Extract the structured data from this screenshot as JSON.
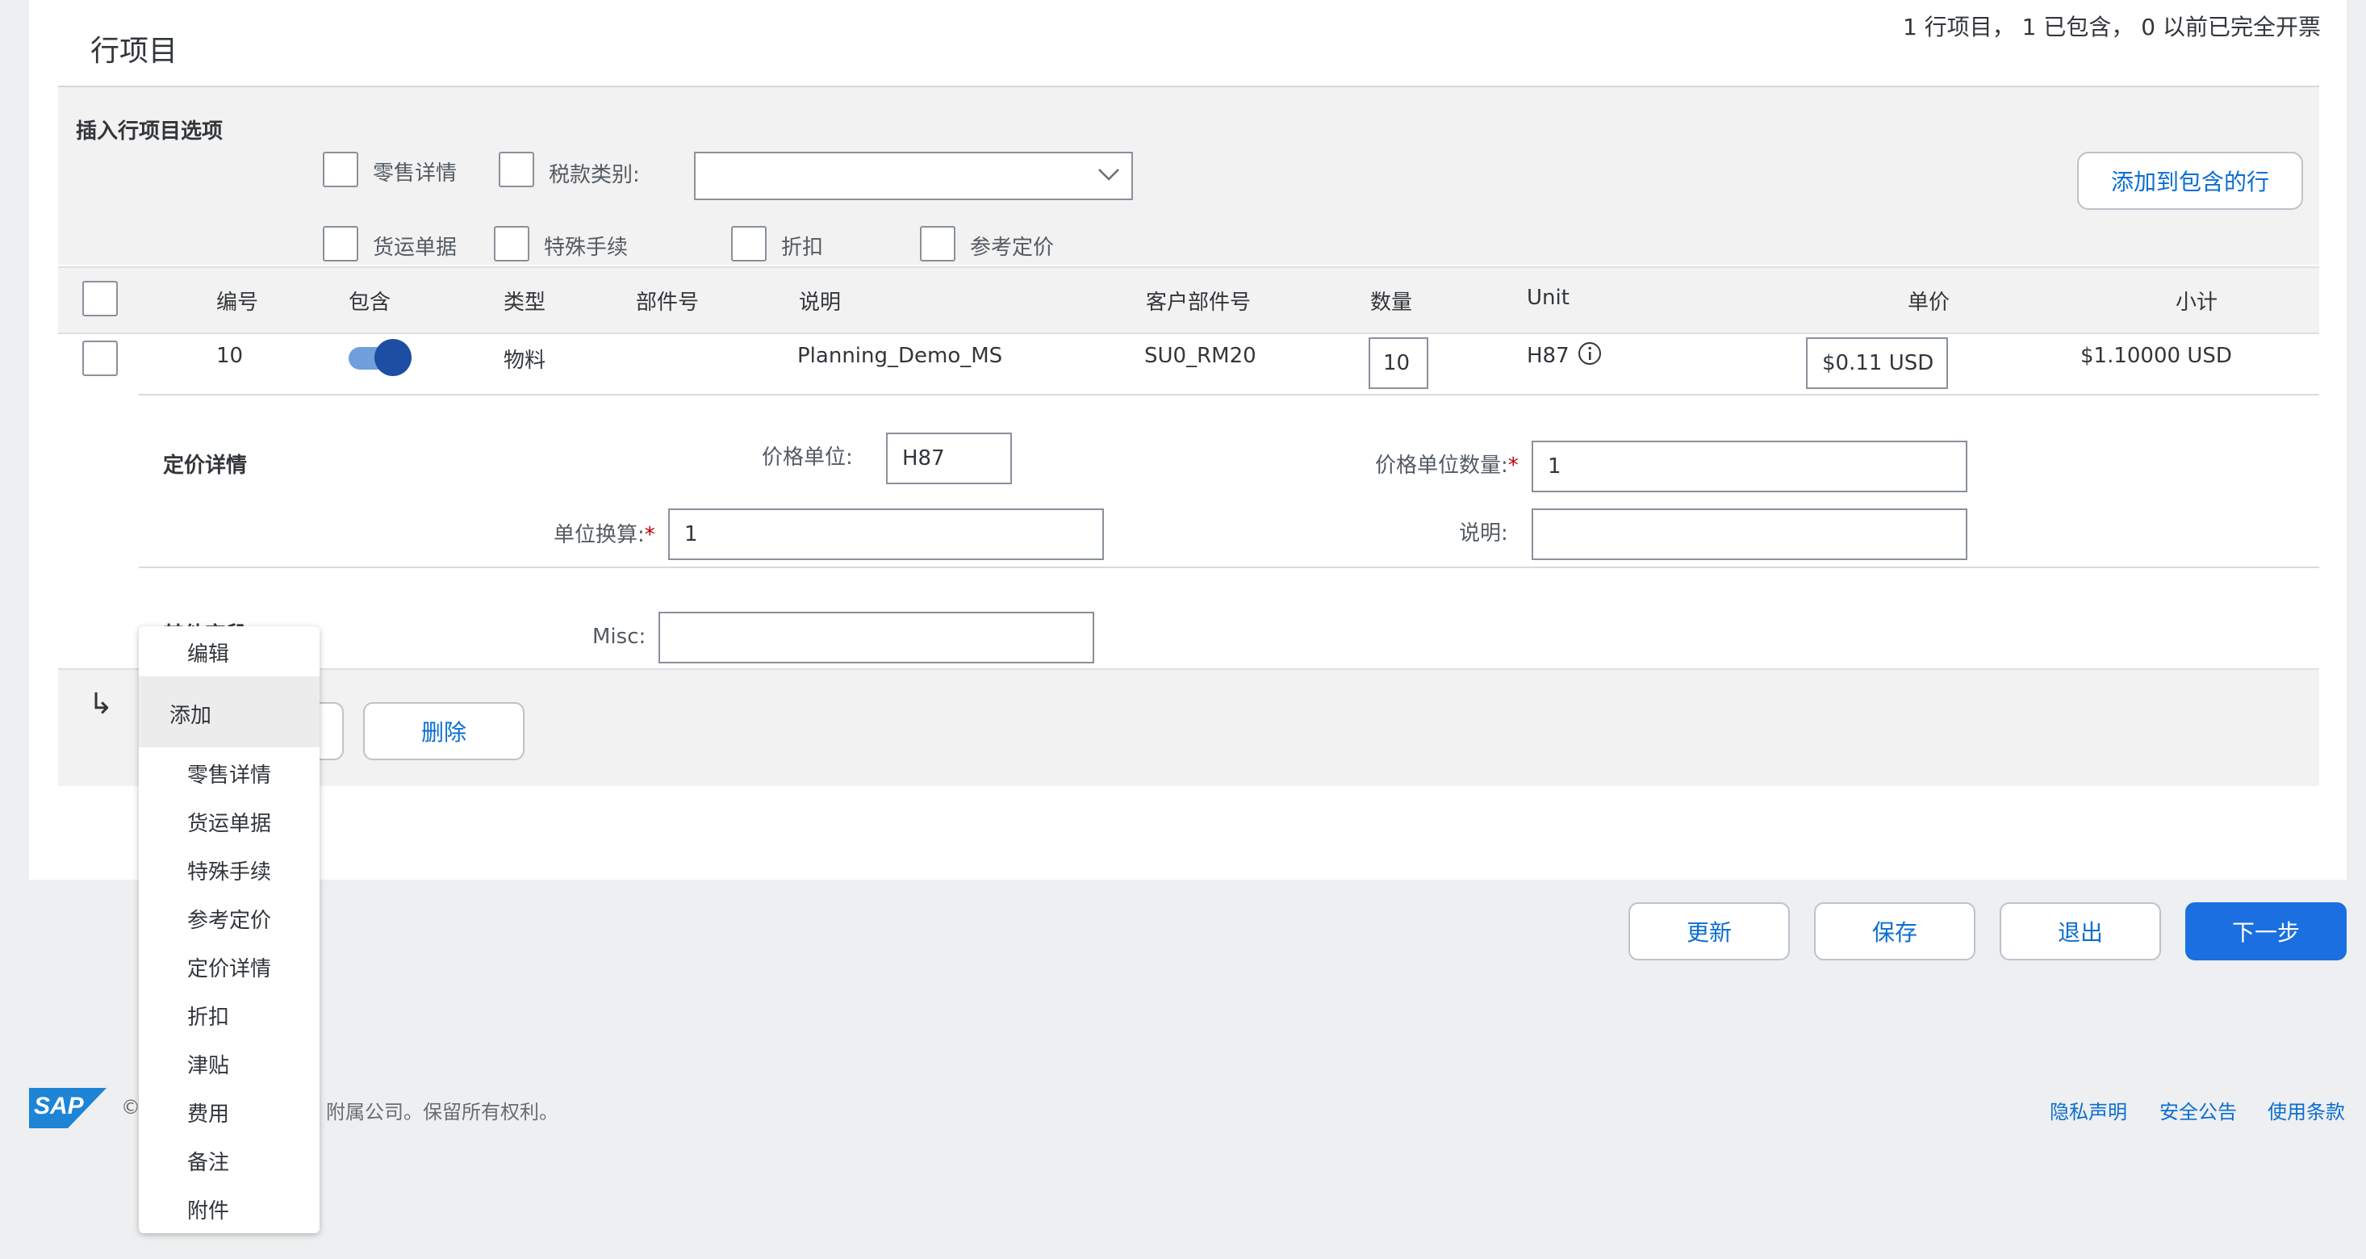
{
  "section": {
    "title": "行项目",
    "summary": "1 行项目，   1 已包含，   0 以前已完全开票"
  },
  "insert_options": {
    "title": "插入行项目选项",
    "checkboxes": {
      "retail_details": "零售详情",
      "tax_category": "税款类别:",
      "shipping_docs": "货运单据",
      "special_handling": "特殊手续",
      "discount": "折扣",
      "reference_pricing": "参考定价"
    },
    "add_to_included_button": "添加到包含的行"
  },
  "table": {
    "headers": {
      "number": "编号",
      "include": "包含",
      "type": "类型",
      "part_no": "部件号",
      "description": "说明",
      "customer_part_no": "客户部件号",
      "quantity": "数量",
      "unit": "Unit",
      "unit_price": "单价",
      "subtotal": "小计"
    },
    "rows": [
      {
        "number": "10",
        "include": true,
        "type": "物料",
        "part_no": "",
        "description": "Planning_Demo_MS",
        "customer_part_no": "SU0_RM20",
        "quantity": "10",
        "unit": "H87",
        "unit_price": "$0.11 USD",
        "subtotal": "$1.10000 USD"
      }
    ]
  },
  "pricing_details": {
    "title": "定价详情",
    "price_unit_label": "价格单位:",
    "price_unit_value": "H87",
    "price_unit_qty_label": "价格单位数量:",
    "price_unit_qty_value": "1",
    "unit_conversion_label": "单位换算:",
    "unit_conversion_value": "1",
    "description_label": "说明:",
    "description_value": ""
  },
  "other_fields": {
    "title_partial": "其他字段",
    "misc_label": "Misc:",
    "misc_value": ""
  },
  "actions_row": {
    "arrow": "↳",
    "delete_button": "删除"
  },
  "dropdown_menu": {
    "items": [
      "编辑",
      "添加",
      "零售详情",
      "货运单据",
      "特殊手续",
      "参考定价",
      "定价详情",
      "折扣",
      "津贴",
      "费用",
      "备注",
      "附件"
    ]
  },
  "footer_buttons": {
    "update": "更新",
    "save": "保存",
    "exit": "退出",
    "next": "下一步"
  },
  "footer": {
    "logo_text": "SAP",
    "copyright_start": "©",
    "copyright_rest": "附属公司。保留所有权利。",
    "links": [
      "隐私声明",
      "安全公告",
      "使用条款"
    ]
  },
  "colors": {
    "accent": "#0a6ed1",
    "primary_button": "#1b6fe0",
    "required": "#bb0000",
    "sap_blue": "#1d84d6"
  }
}
